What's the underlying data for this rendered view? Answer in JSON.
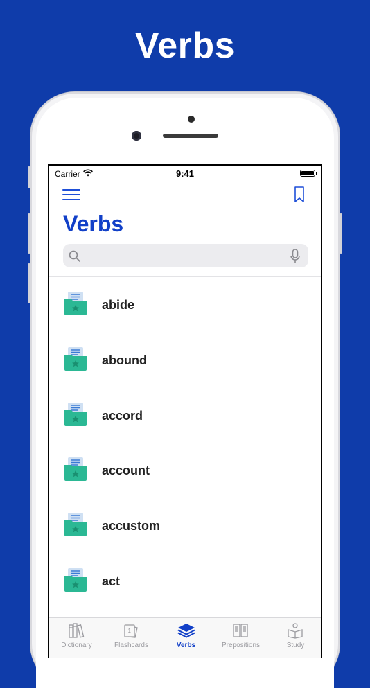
{
  "hero": {
    "title": "Verbs"
  },
  "statusbar": {
    "carrier": "Carrier",
    "time": "9:41"
  },
  "nav": {
    "title": "Verbs",
    "menu_icon": "hamburger-icon",
    "bookmark_icon": "bookmark-icon"
  },
  "search": {
    "placeholder": "",
    "value": ""
  },
  "items": [
    {
      "label": "abide"
    },
    {
      "label": "abound"
    },
    {
      "label": "accord"
    },
    {
      "label": "account"
    },
    {
      "label": "accustom"
    },
    {
      "label": "act"
    }
  ],
  "tabs": [
    {
      "label": "Dictionary",
      "icon": "books-icon",
      "active": false
    },
    {
      "label": "Flashcards",
      "icon": "flashcards-icon",
      "active": false
    },
    {
      "label": "Verbs",
      "icon": "layers-icon",
      "active": true
    },
    {
      "label": "Prepositions",
      "icon": "book-open-icon",
      "active": false
    },
    {
      "label": "Study",
      "icon": "reader-icon",
      "active": false
    }
  ],
  "colors": {
    "brand": "#0f3caa",
    "accent": "#1240c8",
    "folder": "#2bb894"
  }
}
